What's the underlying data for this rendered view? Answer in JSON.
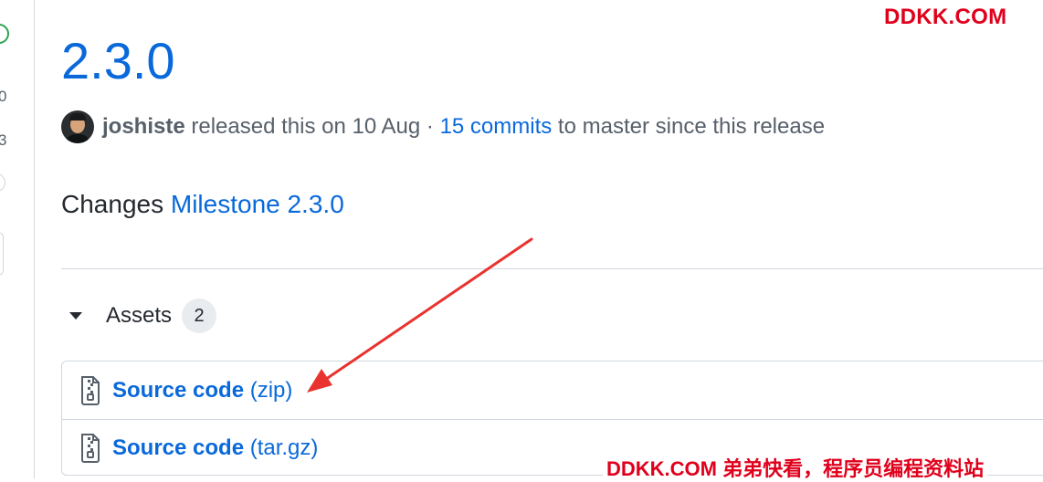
{
  "watermark": {
    "top": "DDKK.COM",
    "bottom": "DDKK.COM 弟弟快看，程序员编程资料站"
  },
  "left_rail": {
    "fragments": [
      "0",
      "3"
    ]
  },
  "release": {
    "version": "2.3.0",
    "author": "joshiste",
    "released_text": " released this on 10 Aug · ",
    "commits_link": "15 commits",
    "commits_suffix": " to master since this release"
  },
  "body": {
    "changes_label": "Changes ",
    "milestone_link": "Milestone 2.3.0"
  },
  "assets": {
    "title": "Assets",
    "count": "2",
    "items": [
      {
        "name": "Source code",
        "ext": " (zip)"
      },
      {
        "name": "Source code",
        "ext": " (tar.gz)"
      }
    ]
  },
  "icons": {
    "caret": "triangle-down-icon",
    "file": "file-zip-icon",
    "annotation": "red-arrow-annotation"
  },
  "colors": {
    "link": "#0969da",
    "watermark": "#e0001b",
    "arrow": "#e8332f",
    "border": "#d0d7de"
  }
}
